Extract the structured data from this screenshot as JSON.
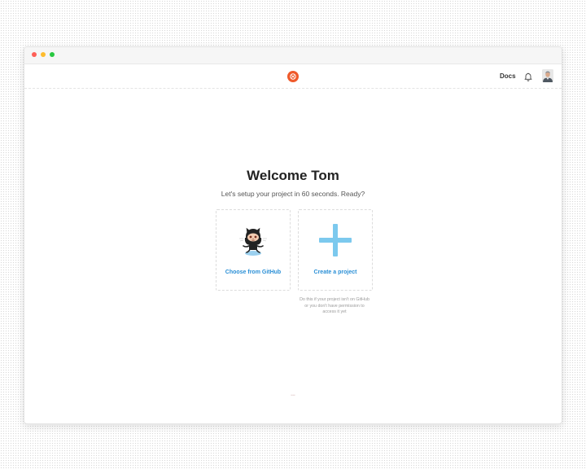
{
  "window": {
    "controls": [
      "close",
      "minimize",
      "maximize"
    ]
  },
  "header": {
    "logo_icon": "flame-logo-icon",
    "logo_color": "#ef5a2b",
    "docs_label": "Docs",
    "notifications_icon": "bell-icon",
    "avatar_icon": "user-avatar"
  },
  "main": {
    "title": "Welcome Tom",
    "subtitle": "Let's setup your project in 60 seconds. Ready?",
    "options": [
      {
        "label": "Choose from GitHub",
        "icon": "octocat-icon"
      },
      {
        "label": "Create a project",
        "icon": "plus-icon",
        "hint": "Do this if your project isn't on GitHub or you don't have permission to access it yet"
      }
    ],
    "footer": "•••••"
  },
  "colors": {
    "accent": "#2a8fd6",
    "plus": "#7cc9ee"
  }
}
